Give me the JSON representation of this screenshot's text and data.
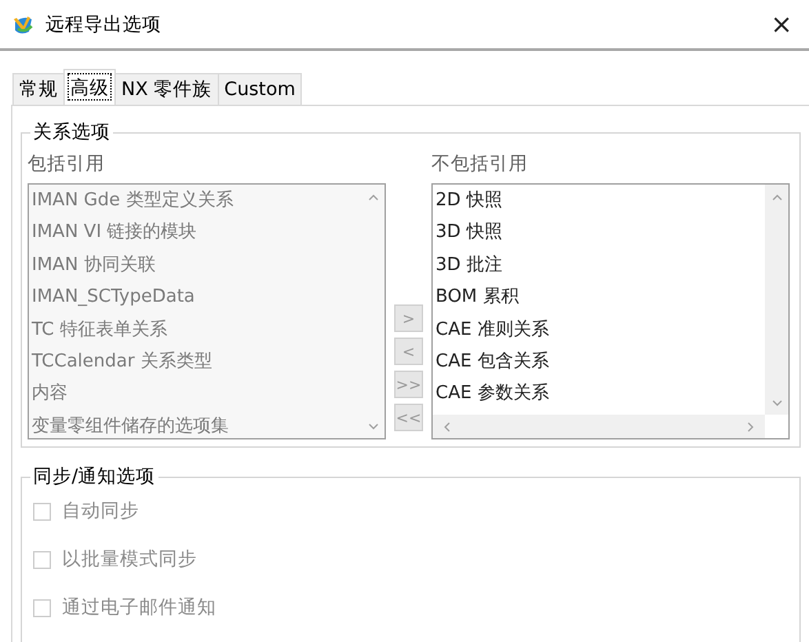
{
  "window": {
    "title": "远程导出选项",
    "close": "×"
  },
  "tabs": [
    {
      "label": "常规",
      "selected": false
    },
    {
      "label": "高级",
      "selected": true
    },
    {
      "label": "NX 零件族",
      "selected": false
    },
    {
      "label": "Custom",
      "selected": false
    }
  ],
  "relation_options": {
    "title": "关系选项",
    "included": {
      "label": "包括引用",
      "disabled": true,
      "items": [
        "IMAN Gde 类型定义关系",
        "IMAN VI 链接的模块",
        "IMAN 协同关联",
        "IMAN_SCTypeData",
        "TC 特征表单关系",
        "TCCalendar 关系类型",
        "内容",
        "变量零组件储存的选项集"
      ]
    },
    "move_buttons": [
      {
        "label": ">",
        "disabled": true
      },
      {
        "label": "<",
        "disabled": true
      },
      {
        "label": ">>",
        "disabled": true
      },
      {
        "label": "<<",
        "disabled": true
      }
    ],
    "excluded": {
      "label": "不包括引用",
      "disabled": false,
      "items": [
        "2D 快照",
        "3D 快照",
        "3D 批注",
        "BOM 累积",
        "CAE 准则关系",
        "CAE 包含关系",
        "CAE 参数关系"
      ]
    }
  },
  "sync_options": {
    "title": "同步/通知选项",
    "checkboxes": [
      {
        "label": "自动同步",
        "checked": false,
        "disabled": true
      },
      {
        "label": "以批量模式同步",
        "checked": false,
        "disabled": true
      },
      {
        "label": "通过电子邮件通知",
        "checked": false,
        "disabled": true
      }
    ]
  }
}
